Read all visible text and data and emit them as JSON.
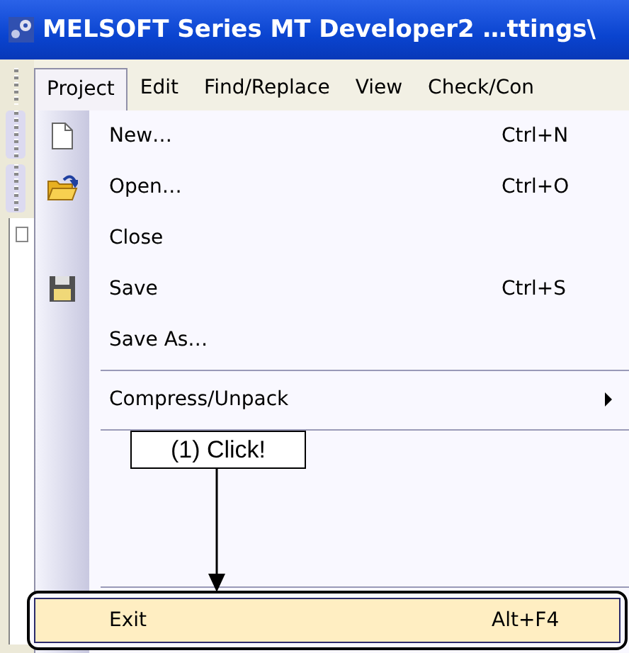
{
  "window": {
    "title": "MELSOFT Series MT Developer2 …ttings\\"
  },
  "menubar": [
    {
      "label": "Project",
      "selected": true
    },
    {
      "label": "Edit",
      "selected": false
    },
    {
      "label": "Find/Replace",
      "selected": false
    },
    {
      "label": "View",
      "selected": false
    },
    {
      "label": "Check/Con",
      "selected": false
    }
  ],
  "menu": [
    {
      "kind": "item",
      "label": "New…",
      "shortcut": "Ctrl+N",
      "selected": false
    },
    {
      "kind": "item",
      "label": "Open…",
      "shortcut": "Ctrl+O",
      "selected": false
    },
    {
      "kind": "item",
      "label": "Close",
      "selected": false
    },
    {
      "kind": "item",
      "label": "Save",
      "shortcut": "Ctrl+S",
      "selected": false
    },
    {
      "kind": "item",
      "label": "Save As…",
      "selected": false
    },
    {
      "kind": "separator"
    },
    {
      "kind": "item",
      "label": "Compress/Unpack",
      "submenu": true,
      "selected": false
    },
    {
      "kind": "separator"
    },
    {
      "kind": "blank"
    },
    {
      "kind": "separator"
    },
    {
      "kind": "item",
      "label": "Exit",
      "shortcut": "Alt+F4",
      "selected": true
    }
  ],
  "callout": {
    "text": "(1) Click!"
  }
}
